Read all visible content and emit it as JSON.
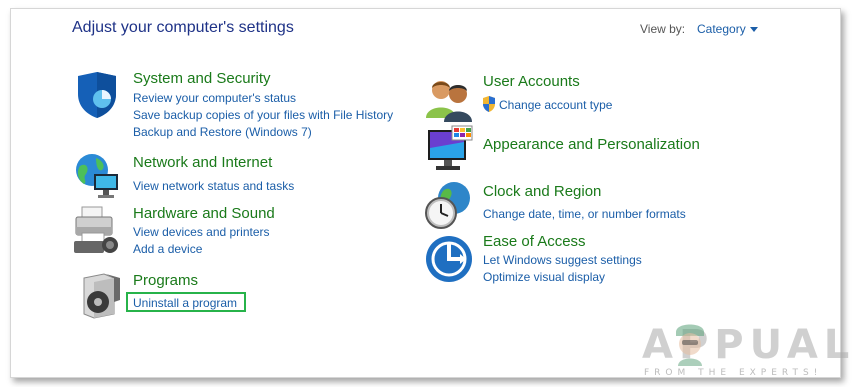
{
  "header": {
    "title": "Adjust your computer's settings",
    "view_by_label": "View by:",
    "view_by_value": "Category"
  },
  "categories": {
    "system_security": {
      "title": "System and Security",
      "links": [
        "Review your computer's status",
        "Save backup copies of your files with File History",
        "Backup and Restore (Windows 7)"
      ]
    },
    "network_internet": {
      "title": "Network and Internet",
      "links": [
        "View network status and tasks"
      ]
    },
    "hardware_sound": {
      "title": "Hardware and Sound",
      "links": [
        "View devices and printers",
        "Add a device"
      ]
    },
    "programs": {
      "title": "Programs",
      "links": [
        "Uninstall a program"
      ]
    },
    "user_accounts": {
      "title": "User Accounts",
      "links": [
        "Change account type"
      ]
    },
    "appearance": {
      "title": "Appearance and Personalization",
      "links": []
    },
    "clock_region": {
      "title": "Clock and Region",
      "links": [
        "Change date, time, or number formats"
      ]
    },
    "ease_access": {
      "title": "Ease of Access",
      "links": [
        "Let Windows suggest settings",
        "Optimize visual display"
      ]
    }
  },
  "watermark": {
    "brand": "APPUALS",
    "tagline": "FROM THE EXPERTS!"
  },
  "colors": {
    "title_blue": "#1e3287",
    "category_green": "#1a7a1a",
    "link_blue": "#1b5ea8",
    "highlight_green": "#27b34a"
  }
}
